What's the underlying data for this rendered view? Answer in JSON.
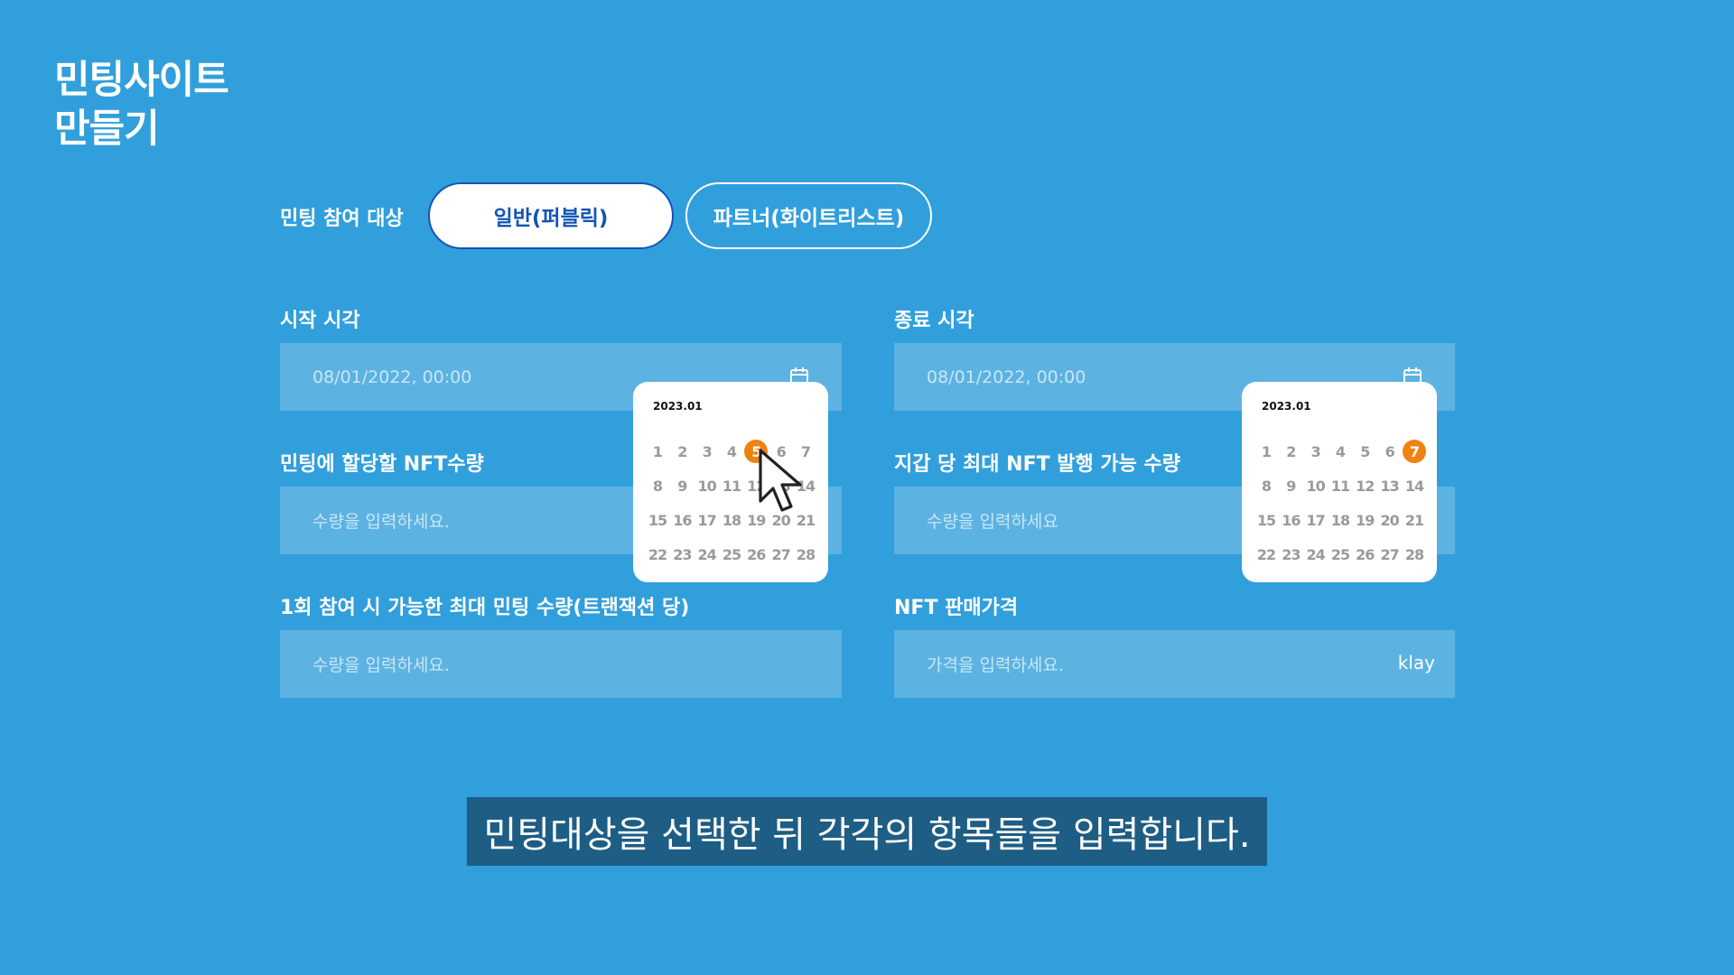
{
  "page_title_line1": "민팅사이트",
  "page_title_line2": "만들기",
  "participation": {
    "label": "민팅 참여 대상",
    "option_public": "일반(퍼블릭)",
    "option_partner": "파트너(화이트리스트)"
  },
  "start_time": {
    "label": "시작 시각",
    "value": "08/01/2022, 00:00"
  },
  "end_time": {
    "label": "종료 시각",
    "value": "08/01/2022, 00:00"
  },
  "nft_allocation": {
    "label": "민팅에 할당할 NFT수량",
    "placeholder": "수량을 입력하세요."
  },
  "wallet_max": {
    "label": "지갑 당 최대 NFT 발행 가능 수량",
    "placeholder": "수량을 입력하세요"
  },
  "per_tx_max": {
    "label": "1회 참여 시 가능한 최대 민팅 수량(트랜잭션 당)",
    "placeholder": "수량을 입력하세요."
  },
  "price": {
    "label": "NFT 판매가격",
    "placeholder": "가격을 입력하세요.",
    "unit": "klay"
  },
  "calendar_start": {
    "month": "2023.01",
    "selected_day": 5,
    "days": [
      [
        "1",
        "2",
        "3",
        "4",
        "5",
        "6",
        "7"
      ],
      [
        "8",
        "9",
        "10",
        "11",
        "12",
        "13",
        "14"
      ],
      [
        "15",
        "16",
        "17",
        "18",
        "19",
        "20",
        "21"
      ],
      [
        "22",
        "23",
        "24",
        "25",
        "26",
        "27",
        "28"
      ]
    ]
  },
  "calendar_end": {
    "month": "2023.01",
    "selected_day": 7,
    "days": [
      [
        "1",
        "2",
        "3",
        "4",
        "5",
        "6",
        "7"
      ],
      [
        "8",
        "9",
        "10",
        "11",
        "12",
        "13",
        "14"
      ],
      [
        "15",
        "16",
        "17",
        "18",
        "19",
        "20",
        "21"
      ],
      [
        "22",
        "23",
        "24",
        "25",
        "26",
        "27",
        "28"
      ]
    ]
  },
  "caption": "민팅대상을 선택한 뒤 각각의 항목들을 입력합니다.",
  "colors": {
    "background": "#319fdc",
    "selected_day": "#f0820f",
    "active_pill_text": "#1255b5",
    "caption_bg": "#1e5d84"
  }
}
